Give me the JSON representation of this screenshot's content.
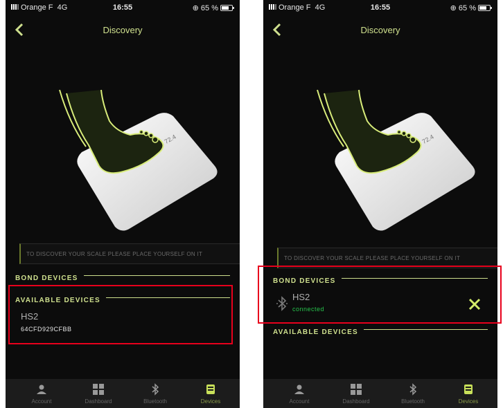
{
  "status_bar": {
    "carrier": "Orange F",
    "network": "4G",
    "time": "16:55",
    "battery": "65 %"
  },
  "nav": {
    "title": "Discovery"
  },
  "illustration": {
    "scale_readout": "8 72.4"
  },
  "hint": "TO DISCOVER YOUR SCALE PLEASE PLACE YOURSELF ON IT",
  "sections": {
    "bond": "BOND DEVICES",
    "available": "AVAILABLE DEVICES"
  },
  "left_screen": {
    "available_device": {
      "name": "HS2",
      "mac": "64CFD929CFBB"
    }
  },
  "right_screen": {
    "bond_device": {
      "name": "HS2",
      "status": "connected"
    }
  },
  "tabs": [
    {
      "label": "Account",
      "icon": "person-icon"
    },
    {
      "label": "Dashboard",
      "icon": "grid-icon"
    },
    {
      "label": "Bluetooth",
      "icon": "bluetooth-icon"
    },
    {
      "label": "Devices",
      "icon": "scale-icon",
      "active": true
    }
  ],
  "colors": {
    "background": "#0c0c0c",
    "accent": "#cfe08e",
    "connected": "#27c24c",
    "highlight": "#e8001c"
  }
}
